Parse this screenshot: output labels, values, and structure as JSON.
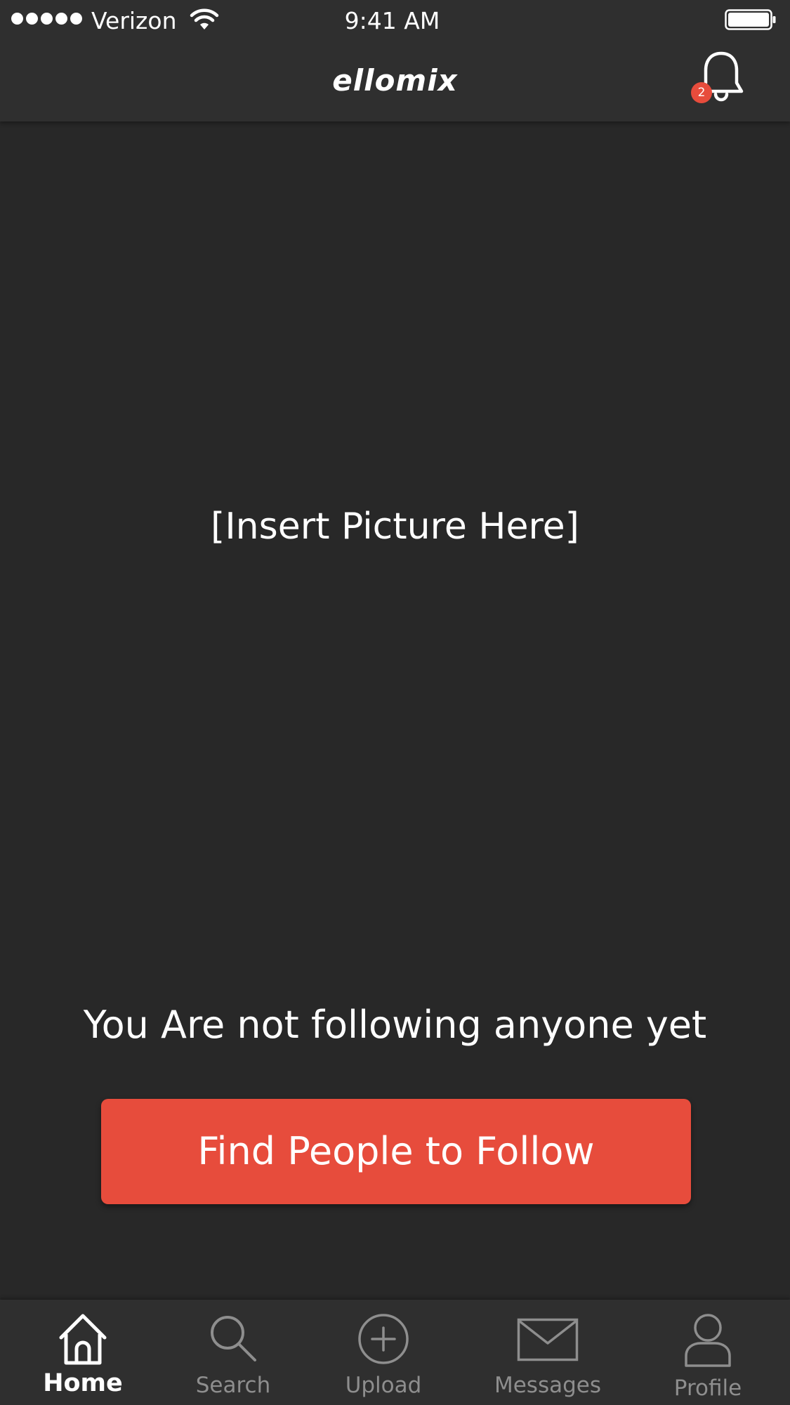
{
  "status_bar": {
    "carrier": "Verizon",
    "time": "9:41 AM",
    "signal_icon": "signal-dots-icon",
    "wifi_icon": "wifi-icon",
    "battery_icon": "battery-icon"
  },
  "header": {
    "title": "ellomix",
    "notifications_icon": "bell-icon",
    "notification_count": "2"
  },
  "main": {
    "picture_placeholder": "[Insert Picture Here]",
    "empty_message": "You Are not following anyone yet",
    "find_button_label": "Find People to Follow"
  },
  "tab_bar": {
    "tabs": [
      {
        "label": "Home",
        "icon": "home-icon",
        "active": true
      },
      {
        "label": "Search",
        "icon": "search-icon",
        "active": false
      },
      {
        "label": "Upload",
        "icon": "plus-circle-icon",
        "active": false
      },
      {
        "label": "Messages",
        "icon": "envelope-icon",
        "active": false
      },
      {
        "label": "Profile",
        "icon": "user-icon",
        "active": false
      }
    ]
  },
  "colors": {
    "background": "#282828",
    "bar_background": "#2f2f2f",
    "accent": "#e74c3c",
    "inactive_tab": "#8e8e8e"
  }
}
